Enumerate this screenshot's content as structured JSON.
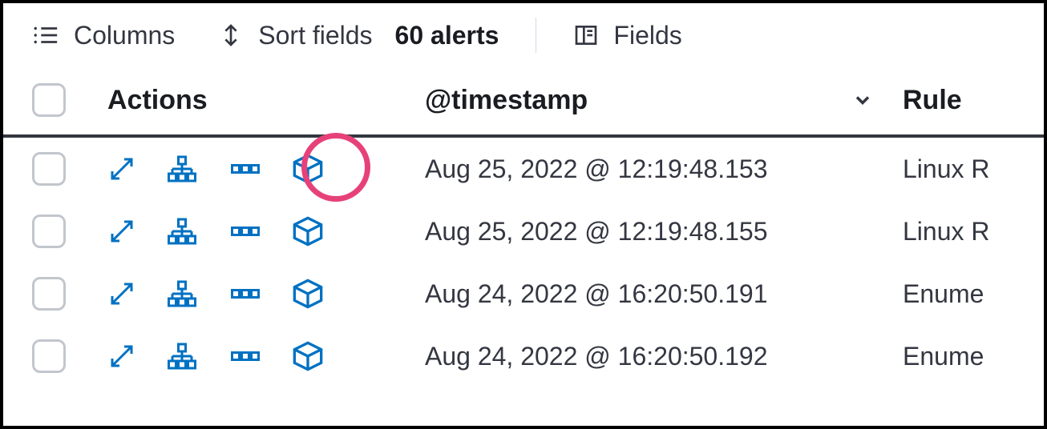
{
  "toolbar": {
    "columns_label": "Columns",
    "sort_label": "Sort fields",
    "alerts_count": "60 alerts",
    "fields_label": "Fields"
  },
  "headers": {
    "actions": "Actions",
    "timestamp": "@timestamp",
    "rule": "Rule"
  },
  "rows": [
    {
      "timestamp": "Aug 25, 2022 @ 12:19:48.153",
      "rule": "Linux R",
      "highlighted": true
    },
    {
      "timestamp": "Aug 25, 2022 @ 12:19:48.155",
      "rule": "Linux R",
      "highlighted": false
    },
    {
      "timestamp": "Aug 24, 2022 @ 16:20:50.191",
      "rule": "Enume",
      "highlighted": false
    },
    {
      "timestamp": "Aug 24, 2022 @ 16:20:50.192",
      "rule": "Enume",
      "highlighted": false
    }
  ]
}
